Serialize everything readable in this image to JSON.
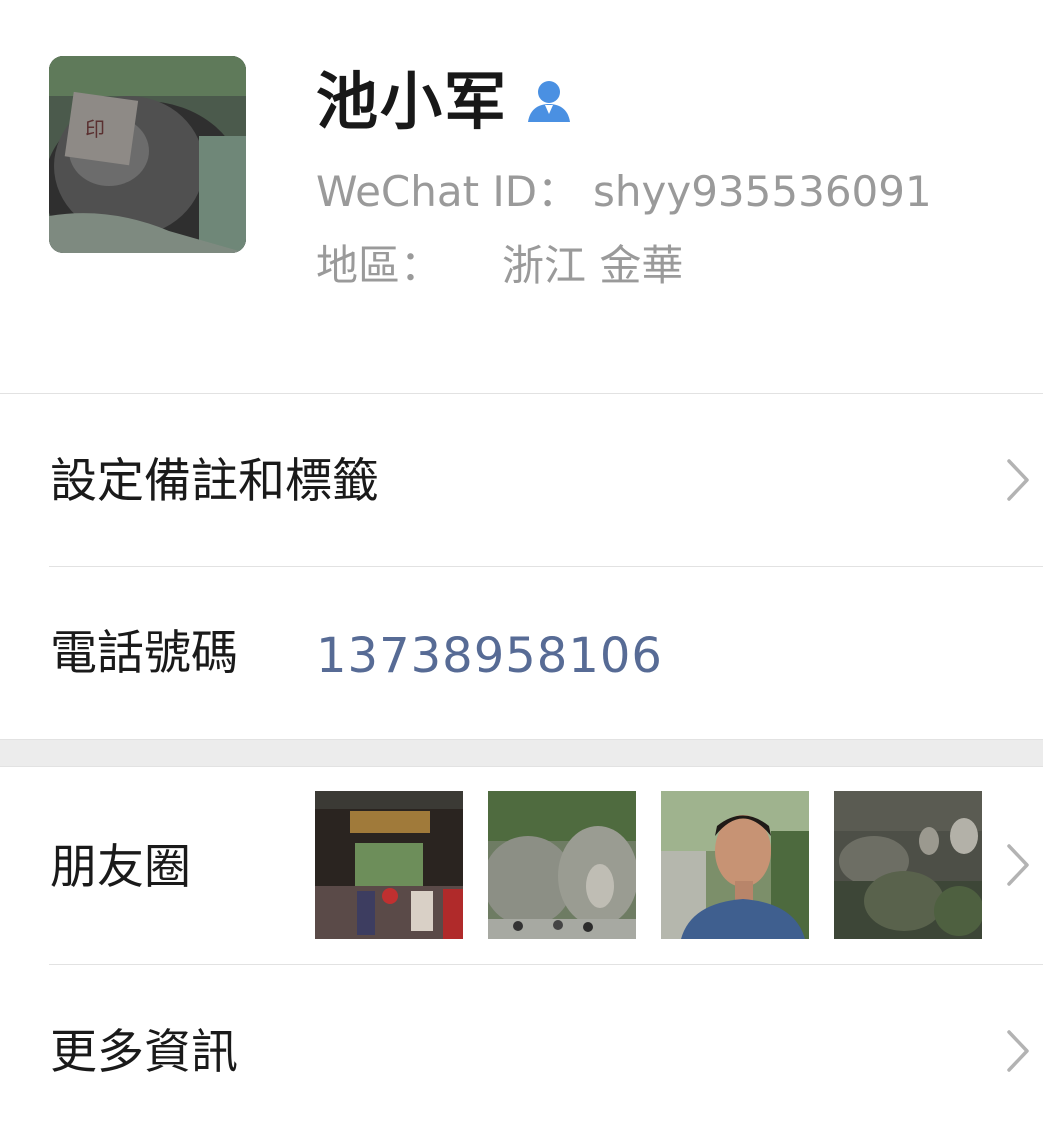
{
  "profile": {
    "name": "池小军",
    "wechat_id_label": "WeChat ID：",
    "wechat_id": "shyy935536091",
    "region_label": "地區：",
    "region": "浙江  金華",
    "contact_icon": "person-icon",
    "accent_color": "#4a90e2"
  },
  "rows": {
    "remark_label": "設定備註和標籤",
    "phone_label": "電話號碼",
    "phone_value": "13738958106",
    "moments_label": "朋友圈",
    "more_label": "更多資訊"
  },
  "moments": {
    "thumbnails": [
      "temple-gate-photo",
      "buddha-rock-carving-photo",
      "man-portrait-photo",
      "cliff-carvings-photo"
    ]
  },
  "colors": {
    "link_blue": "#576b95",
    "separator": "#e2e2e2",
    "gap_band": "#ececec"
  }
}
